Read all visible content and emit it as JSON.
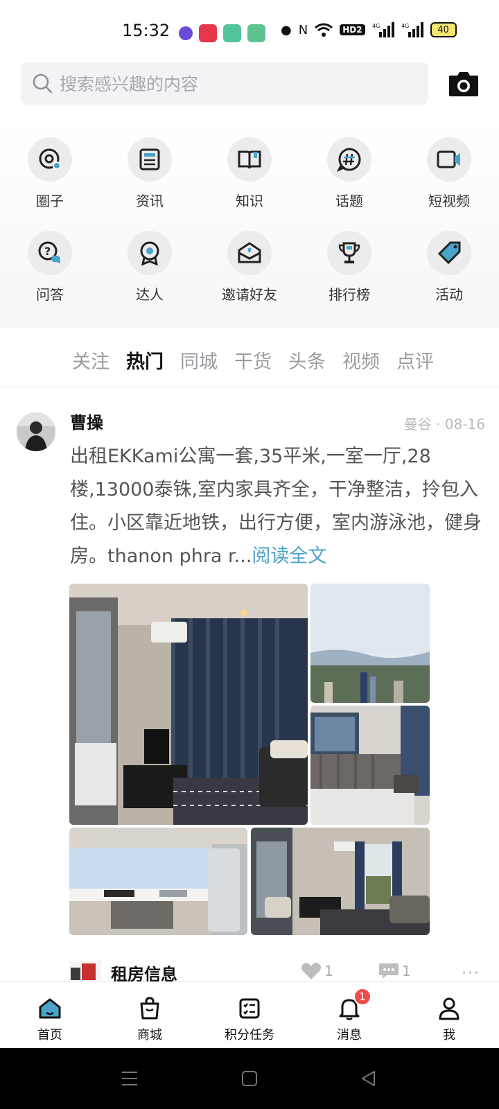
{
  "status_bar": {
    "time": "15:32",
    "hd_label": "HD2",
    "battery": "40",
    "app_colors": [
      "#6b4bd8",
      "#e8364a",
      "#53c39a",
      "#5cc38e"
    ]
  },
  "search": {
    "placeholder": "搜索感兴趣的内容",
    "icon": "search-icon",
    "camera_icon": "camera-icon"
  },
  "quick_nav": [
    {
      "label": "圈子",
      "icon": "circle-at-icon"
    },
    {
      "label": "资讯",
      "icon": "news-icon"
    },
    {
      "label": "知识",
      "icon": "book-icon"
    },
    {
      "label": "话题",
      "icon": "hashtag-chat-icon"
    },
    {
      "label": "短视频",
      "icon": "video-camera-icon"
    },
    {
      "label": "问答",
      "icon": "question-chat-icon"
    },
    {
      "label": "达人",
      "icon": "badge-person-icon"
    },
    {
      "label": "邀请好友",
      "icon": "invite-mail-icon"
    },
    {
      "label": "排行榜",
      "icon": "trophy-icon"
    },
    {
      "label": "活动",
      "icon": "tag-icon"
    }
  ],
  "tabs": [
    "关注",
    "热门",
    "同城",
    "干货",
    "头条",
    "视频",
    "点评"
  ],
  "active_tab": "热门",
  "post": {
    "author": "曹操",
    "meta": "曼谷 · 08-16",
    "body": "出租EKKami公寓一套,35平米,一室一厅,28楼,13000泰铢,室内家具齐全，干净整洁，拎包入住。小区靠近地铁，出行方便，室内游泳池，健身房。thanon phra r...",
    "read_more": "阅读全文"
  },
  "next_post": {
    "title": "租房信息",
    "likes": "1",
    "comments": "1",
    "more": "···"
  },
  "bottom_nav": [
    {
      "label": "首页",
      "icon": "home-icon"
    },
    {
      "label": "商城",
      "icon": "shopping-bag-icon"
    },
    {
      "label": "积分任务",
      "icon": "task-list-icon"
    },
    {
      "label": "消息",
      "icon": "bell-icon",
      "badge": "1"
    },
    {
      "label": "我",
      "icon": "person-icon"
    }
  ],
  "colors": {
    "accent_link": "#4aa3c8",
    "badge": "#f04b4b",
    "icon_accent": "#4aa3c8"
  }
}
